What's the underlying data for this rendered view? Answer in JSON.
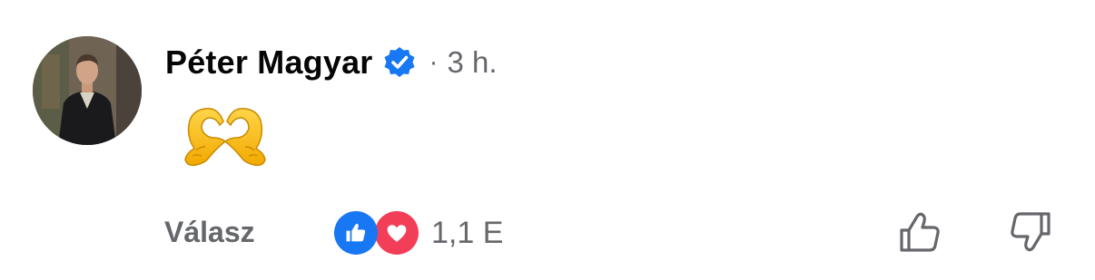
{
  "comment": {
    "author": "Péter Magyar",
    "verified": true,
    "separator": "·",
    "timestamp": "3 h.",
    "content_icon": "heart-hands-emoji"
  },
  "actions": {
    "reply_label": "Válasz",
    "reactions": [
      "like-icon",
      "love-icon"
    ],
    "reaction_count": "1,1 E",
    "thumbs_up_icon": "thumbs-up-outline-icon",
    "thumbs_down_icon": "thumbs-down-outline-icon"
  },
  "colors": {
    "verified_blue": "#1877f2",
    "like_blue": "#1877f2",
    "love_red": "#f33e58",
    "secondary_text": "#65676b",
    "primary_text": "#050505"
  }
}
